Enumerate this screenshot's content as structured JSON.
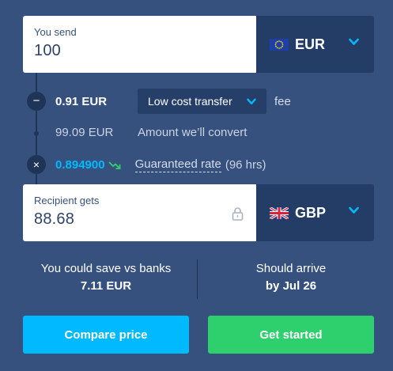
{
  "send": {
    "label": "You send",
    "amount": "100",
    "currency": "EUR",
    "flag_icon": "eu-flag-icon"
  },
  "fees": {
    "fee_amount": "0.91 EUR",
    "fee_option": "Low cost transfer",
    "fee_word": "fee",
    "convert_amount": "99.09 EUR",
    "convert_label": "Amount we’ll convert",
    "rate": "0.894900",
    "rate_link": "Guaranteed rate",
    "rate_duration": "(96 hrs)",
    "minus_symbol": "−",
    "times_symbol": "×"
  },
  "receive": {
    "label": "Recipient gets",
    "amount": "88.68",
    "currency": "GBP",
    "flag_icon": "uk-flag-icon"
  },
  "info": {
    "save_label": "You could save vs banks",
    "save_value": "7.11 EUR",
    "arrive_label": "Should arrive",
    "arrive_value": "by Jul 26"
  },
  "buttons": {
    "compare": "Compare price",
    "start": "Get started"
  },
  "colors": {
    "background": "#37517e",
    "accent_blue": "#00b9ff",
    "accent_green": "#2ed06e",
    "currency_bg": "#243d67"
  }
}
